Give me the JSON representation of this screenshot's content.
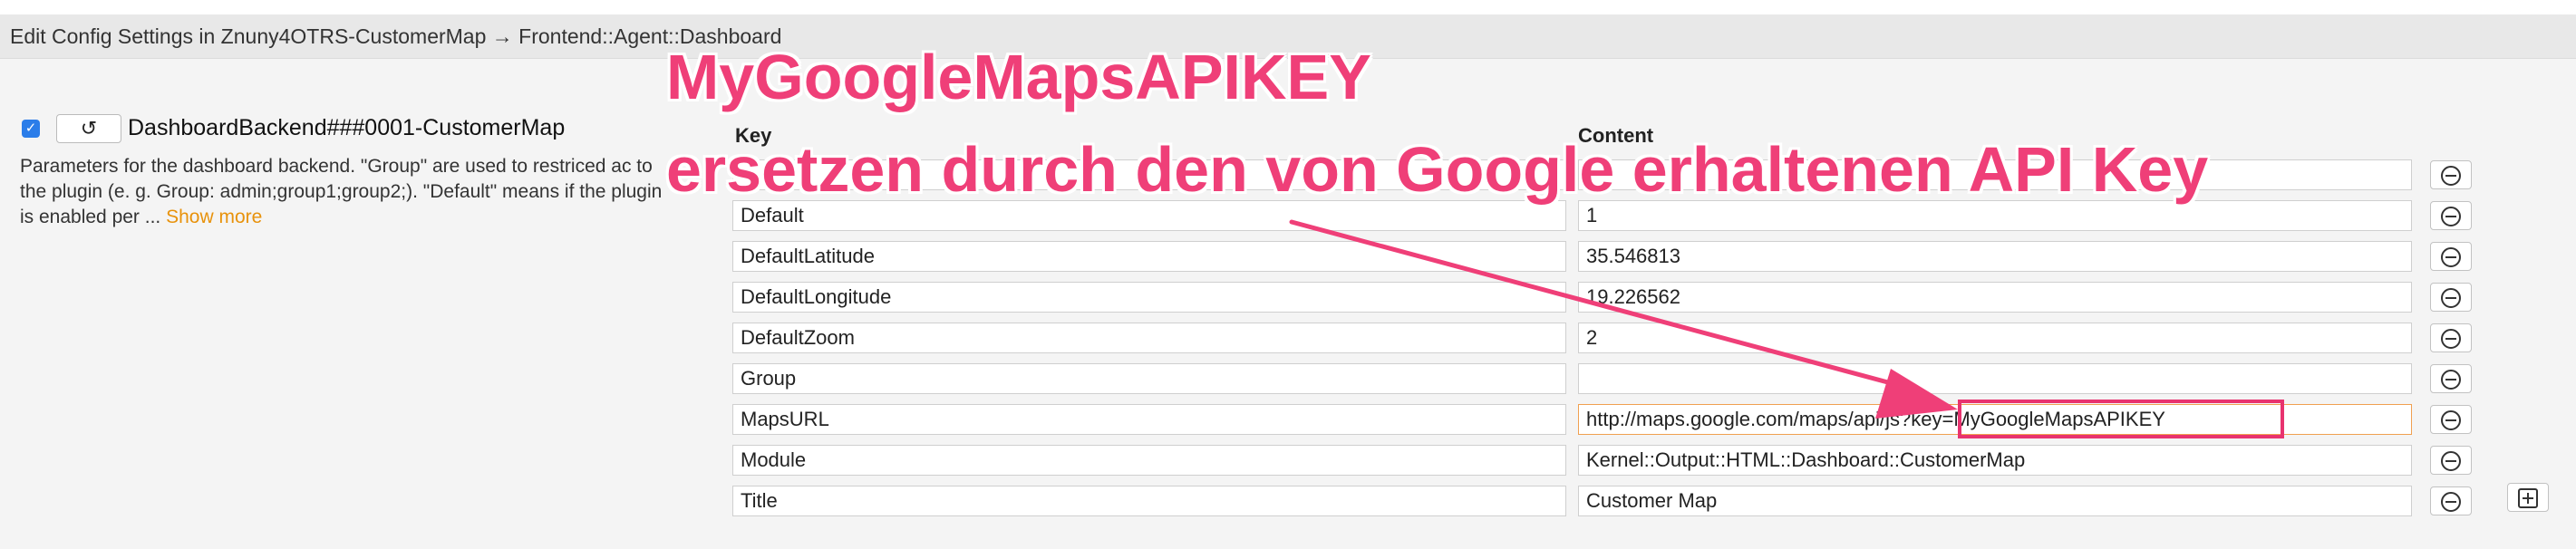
{
  "header": {
    "title": "Edit Config Settings in Znuny4OTRS-CustomerMap → Frontend::Agent::Dashboard"
  },
  "setting": {
    "checked": true,
    "reset_icon": "undo-icon",
    "name": "DashboardBackend###0001-CustomerMap",
    "description": "Parameters for the dashboard backend. \"Group\" are used to restriced ac to the plugin (e. g. Group: admin;group1;group2;). \"Default\" means if the plugin is enabled per ...",
    "show_more": "Show more"
  },
  "table": {
    "key_header": "Key",
    "content_header": "Content",
    "rows": [
      {
        "key": "",
        "value": ""
      },
      {
        "key": "Default",
        "value": "1"
      },
      {
        "key": "DefaultLatitude",
        "value": "35.546813"
      },
      {
        "key": "DefaultLongitude",
        "value": "19.226562"
      },
      {
        "key": "DefaultZoom",
        "value": "2"
      },
      {
        "key": "Group",
        "value": ""
      },
      {
        "key": "MapsURL",
        "value": "http://maps.google.com/maps/api/js?key=MyGoogleMapsAPIKEY"
      },
      {
        "key": "Module",
        "value": "Kernel::Output::HTML::Dashboard::CustomerMap"
      },
      {
        "key": "Title",
        "value": "Customer Map"
      }
    ],
    "remove_icon": "minus-circle-icon",
    "add_icon": "plus-square-icon"
  },
  "annotation": {
    "line1": "MyGoogleMapsAPIKEY",
    "line2": "ersetzen durch den von Google erhaltenen API Key",
    "color": "#ef3f78"
  }
}
